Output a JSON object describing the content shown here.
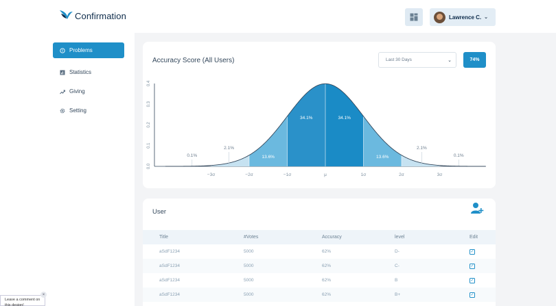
{
  "app": {
    "title": "Confirmation"
  },
  "sidebar": {
    "items": [
      {
        "label": "Problems",
        "icon": "alert-circle-icon",
        "active": true
      },
      {
        "label": "Statistics",
        "icon": "bar-chart-icon",
        "active": false
      },
      {
        "label": "Giving",
        "icon": "gift-icon",
        "active": false
      },
      {
        "label": "Setting",
        "icon": "gear-icon",
        "active": false
      }
    ]
  },
  "header": {
    "user_name": "Lawrence C."
  },
  "accuracy": {
    "title": "Accuracy Score (All Users)",
    "range": "Last 30 Days",
    "score": "74%"
  },
  "chart_data": {
    "type": "area",
    "distribution": "normal",
    "ylim": [
      0,
      0.4
    ],
    "yticks": [
      "0.0",
      "0.1",
      "0.2",
      "0.3",
      "0.4"
    ],
    "xticks": [
      "−3σ",
      "−2σ",
      "−1σ",
      "μ",
      "1σ",
      "2σ",
      "3σ"
    ],
    "x_sigma": [
      -3,
      -2,
      -1,
      0,
      1,
      2,
      3
    ],
    "regions": [
      {
        "from": -3,
        "to": -2,
        "label": "2.1%"
      },
      {
        "from": -2,
        "to": -1,
        "label": "13.6%"
      },
      {
        "from": -1,
        "to": 0,
        "label": "34.1%"
      },
      {
        "from": 0,
        "to": 1,
        "label": "34.1%"
      },
      {
        "from": 1,
        "to": 2,
        "label": "13.6%"
      },
      {
        "from": 2,
        "to": 3,
        "label": "2.1%"
      }
    ],
    "tails": [
      {
        "at": -3.5,
        "label": "0.1%"
      },
      {
        "at": 3.5,
        "label": "0.1%"
      }
    ],
    "colors": {
      "inner": "#1a8bc6",
      "inner_left": "#2a91c9",
      "middle": "#6bb9df",
      "outer": "#c6e2f1",
      "line": "#33475b"
    }
  },
  "users": {
    "title": "User",
    "columns": [
      "Title",
      "#Votes",
      "Accuracy",
      "level",
      "Edit"
    ],
    "rows": [
      {
        "title": "aSdF1234",
        "votes": "5000",
        "accuracy": "62%",
        "level": "D-"
      },
      {
        "title": "aSdF1234",
        "votes": "5000",
        "accuracy": "62%",
        "level": "C-"
      },
      {
        "title": "aSdF1234",
        "votes": "5000",
        "accuracy": "62%",
        "level": "B"
      },
      {
        "title": "aSdF1234",
        "votes": "5000",
        "accuracy": "62%",
        "level": "B+"
      }
    ]
  },
  "comment_widget": {
    "text": "Leave a comment on this design!"
  }
}
